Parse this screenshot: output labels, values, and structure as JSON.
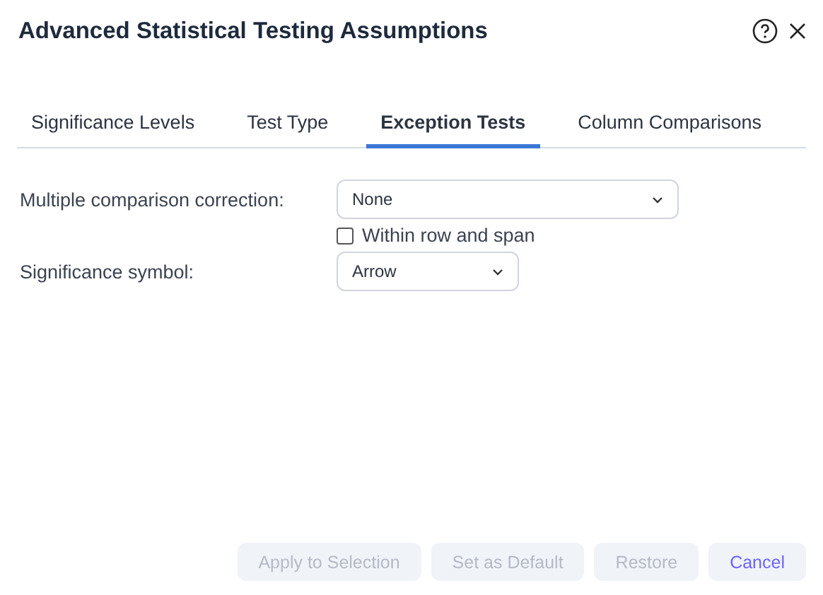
{
  "dialog": {
    "title": "Advanced Statistical Testing Assumptions"
  },
  "tabs": [
    {
      "label": "Significance Levels",
      "selected": false
    },
    {
      "label": "Test Type",
      "selected": false
    },
    {
      "label": "Exception Tests",
      "selected": true
    },
    {
      "label": "Column Comparisons",
      "selected": false
    }
  ],
  "fields": [
    {
      "kind": "select",
      "label": "Multiple comparison correction:",
      "value": "None",
      "wide": true
    },
    {
      "kind": "checkbox",
      "label": "Within row and span",
      "checked": false
    },
    {
      "kind": "select",
      "label": "Significance symbol:",
      "value": "Arrow",
      "wide": false
    }
  ],
  "buttons": [
    {
      "label": "Apply to Selection",
      "disabled": true
    },
    {
      "label": "Set as Default",
      "disabled": true
    },
    {
      "label": "Restore",
      "disabled": true
    },
    {
      "label": "Cancel",
      "disabled": false
    }
  ]
}
